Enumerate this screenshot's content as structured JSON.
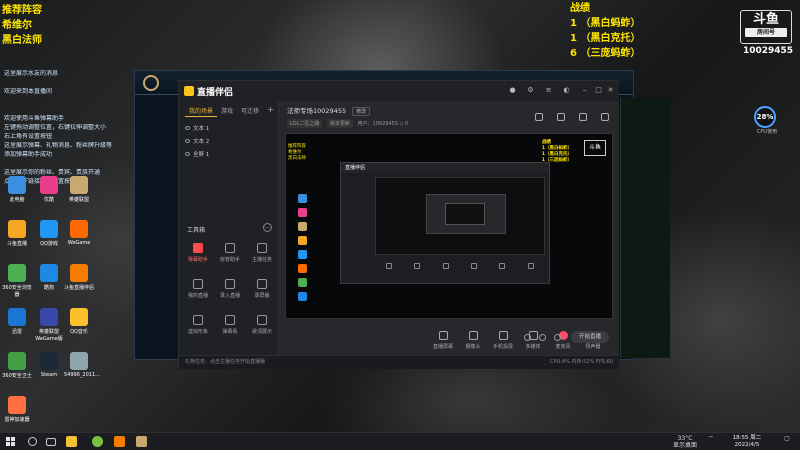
{
  "stream_overlay": {
    "title": "推荐阵容",
    "line1": "希维尔",
    "line2": "黑白法师",
    "record_title": "战绩",
    "records": [
      "1 （黑白蚂蚱）",
      "1 （黑白克托）",
      "6 （三庞蚂蚱）"
    ],
    "brand_logo": "斗鱼",
    "brand_sub": "房间号",
    "room_number": "10029455"
  },
  "chat_log": [
    "这里展示水友的消息",
    "",
    "欢迎来到本直播间",
    "",
    "",
    "欢迎使用斗鱼弹幕助手",
    "左键拖动调整位置，右键拉伸调整大小",
    "右上角有设置按钮",
    "这里展示弹幕、礼物消息、粉丝牌升级等",
    "添加弹幕助手成功",
    "",
    "这里展示你的粉丝、贵宾、贵族开通",
    "点击以下链接可以设置按钮"
  ],
  "desktop_icons": [
    {
      "label": "此电脑",
      "color": "#3b8ee0"
    },
    {
      "label": "优酷",
      "color": "#e83e8c"
    },
    {
      "label": "英雄联盟",
      "color": "#c8aa6e"
    },
    {
      "label": "斗鱼直播",
      "color": "#f5a623"
    },
    {
      "label": "QQ游戏",
      "color": "#2196f3"
    },
    {
      "label": "WeGame",
      "color": "#ff6a00"
    },
    {
      "label": "360安全浏览器",
      "color": "#4caf50"
    },
    {
      "label": "酷狗",
      "color": "#1e88e5"
    },
    {
      "label": "斗鱼直播伴侣",
      "color": "#f57c00"
    },
    {
      "label": "迅雷",
      "color": "#1976d2"
    },
    {
      "label": "英雄联盟WeGame版",
      "color": "#3949ab"
    },
    {
      "label": "QQ音乐",
      "color": "#fbc02d"
    },
    {
      "label": "360安全卫士",
      "color": "#43a047"
    },
    {
      "label": "Steam",
      "color": "#1b2838"
    },
    {
      "label": "54996_2011...",
      "color": "#90a4ae"
    },
    {
      "label": "雷神加速器",
      "color": "#ff7043"
    }
  ],
  "app": {
    "name": "直播伴侣",
    "left_tabs": [
      "我的场景",
      "游戏",
      "可迁移"
    ],
    "scenes": [
      "文本 1",
      "文本 2",
      "全屏 1"
    ],
    "tools_title": "工具箱",
    "tools": [
      {
        "label": "弹幕助手",
        "hot": true
      },
      {
        "label": "房管助手",
        "hot": false
      },
      {
        "label": "主播任务",
        "hot": false
      },
      {
        "label": "我的直播",
        "hot": false
      },
      {
        "label": "录入直播",
        "hot": false
      },
      {
        "label": "录屏播",
        "hot": false
      },
      {
        "label": "虚拟形象",
        "hot": false
      },
      {
        "label": "弹幕看",
        "hot": false
      },
      {
        "label": "歌词展示",
        "hot": false
      }
    ],
    "room_title": "法师专场10029455",
    "room_chip": "修改",
    "sub_chips": [
      "LOL二区之路",
      "版本更新"
    ],
    "fans_label": "用户：10029455",
    "gift_count": "0",
    "preview": {
      "overlay_left": [
        "推荐阵容",
        "希维尔",
        "黑白法师"
      ],
      "overlay_right": [
        "战绩",
        "1（黑白蚂蚱）",
        "1（黑白克托）",
        "1（三庞蚂蚱）"
      ],
      "logo": "斗鱼",
      "inner_title": "直播伴侣"
    },
    "bottom_tools": [
      "直播屏幕",
      "摄像头",
      "手机投屏",
      "多媒体",
      "麦克风",
      "扬声器"
    ],
    "start_label": "开始直播",
    "status_left": "礼物任务：点击主播任务开始直播赚",
    "status_right": "CPU:4%  内存:52%  FPS:60"
  },
  "perf": {
    "cpu_value": "28%",
    "cpu_label": "CPU使用"
  },
  "taskbar": {
    "weather_temp": "33°C",
    "weather_desc": "显示桌面",
    "time": "18:55 周二",
    "date": "2022/4/5"
  }
}
